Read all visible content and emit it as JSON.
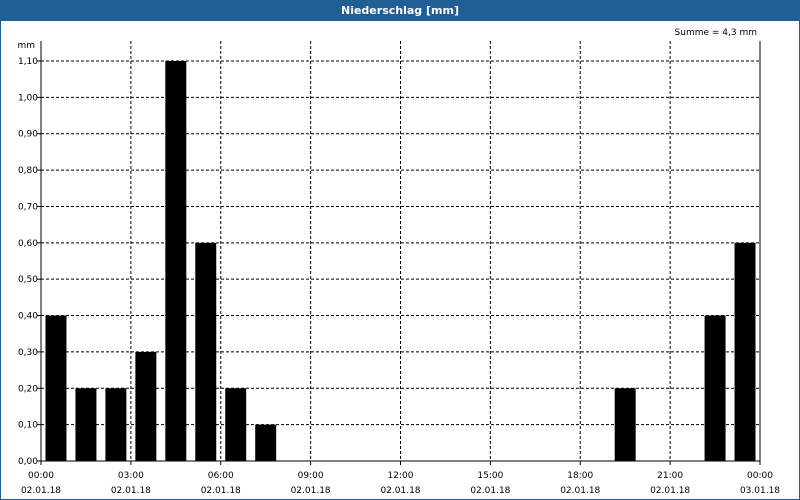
{
  "window": {
    "title": "Niederschlag [mm]"
  },
  "chart_data": {
    "type": "bar",
    "title": "Niederschlag [mm]",
    "ylabel": "mm",
    "xlabel": "",
    "ylim": [
      0,
      1.1
    ],
    "y_ticks": [
      "0,00",
      "0,10",
      "0,20",
      "0,30",
      "0,40",
      "0,50",
      "0,60",
      "0,70",
      "0,80",
      "0,90",
      "1,00",
      "1,10"
    ],
    "x_tick_times": [
      "00:00",
      "03:00",
      "06:00",
      "09:00",
      "12:00",
      "15:00",
      "18:00",
      "21:00",
      "00:00"
    ],
    "x_tick_dates": [
      "02.01.18",
      "02.01.18",
      "02.01.18",
      "02.01.18",
      "02.01.18",
      "02.01.18",
      "02.01.18",
      "02.01.18",
      "03.01.18"
    ],
    "categories": [
      "00:00",
      "01:00",
      "02:00",
      "03:00",
      "04:00",
      "05:00",
      "06:00",
      "07:00",
      "08:00",
      "09:00",
      "10:00",
      "11:00",
      "12:00",
      "13:00",
      "14:00",
      "15:00",
      "16:00",
      "17:00",
      "18:00",
      "19:00",
      "20:00",
      "21:00",
      "22:00",
      "23:00"
    ],
    "values": [
      0.4,
      0.2,
      0.2,
      0.3,
      1.1,
      0.6,
      0.2,
      0.1,
      0,
      0,
      0,
      0,
      0,
      0,
      0,
      0,
      0,
      0,
      0,
      0.2,
      0,
      0,
      0.4,
      0.6
    ],
    "summary": "Summe = 4,3 mm",
    "bar_color": "#000000",
    "grid": true,
    "grid_style": "dashed"
  }
}
